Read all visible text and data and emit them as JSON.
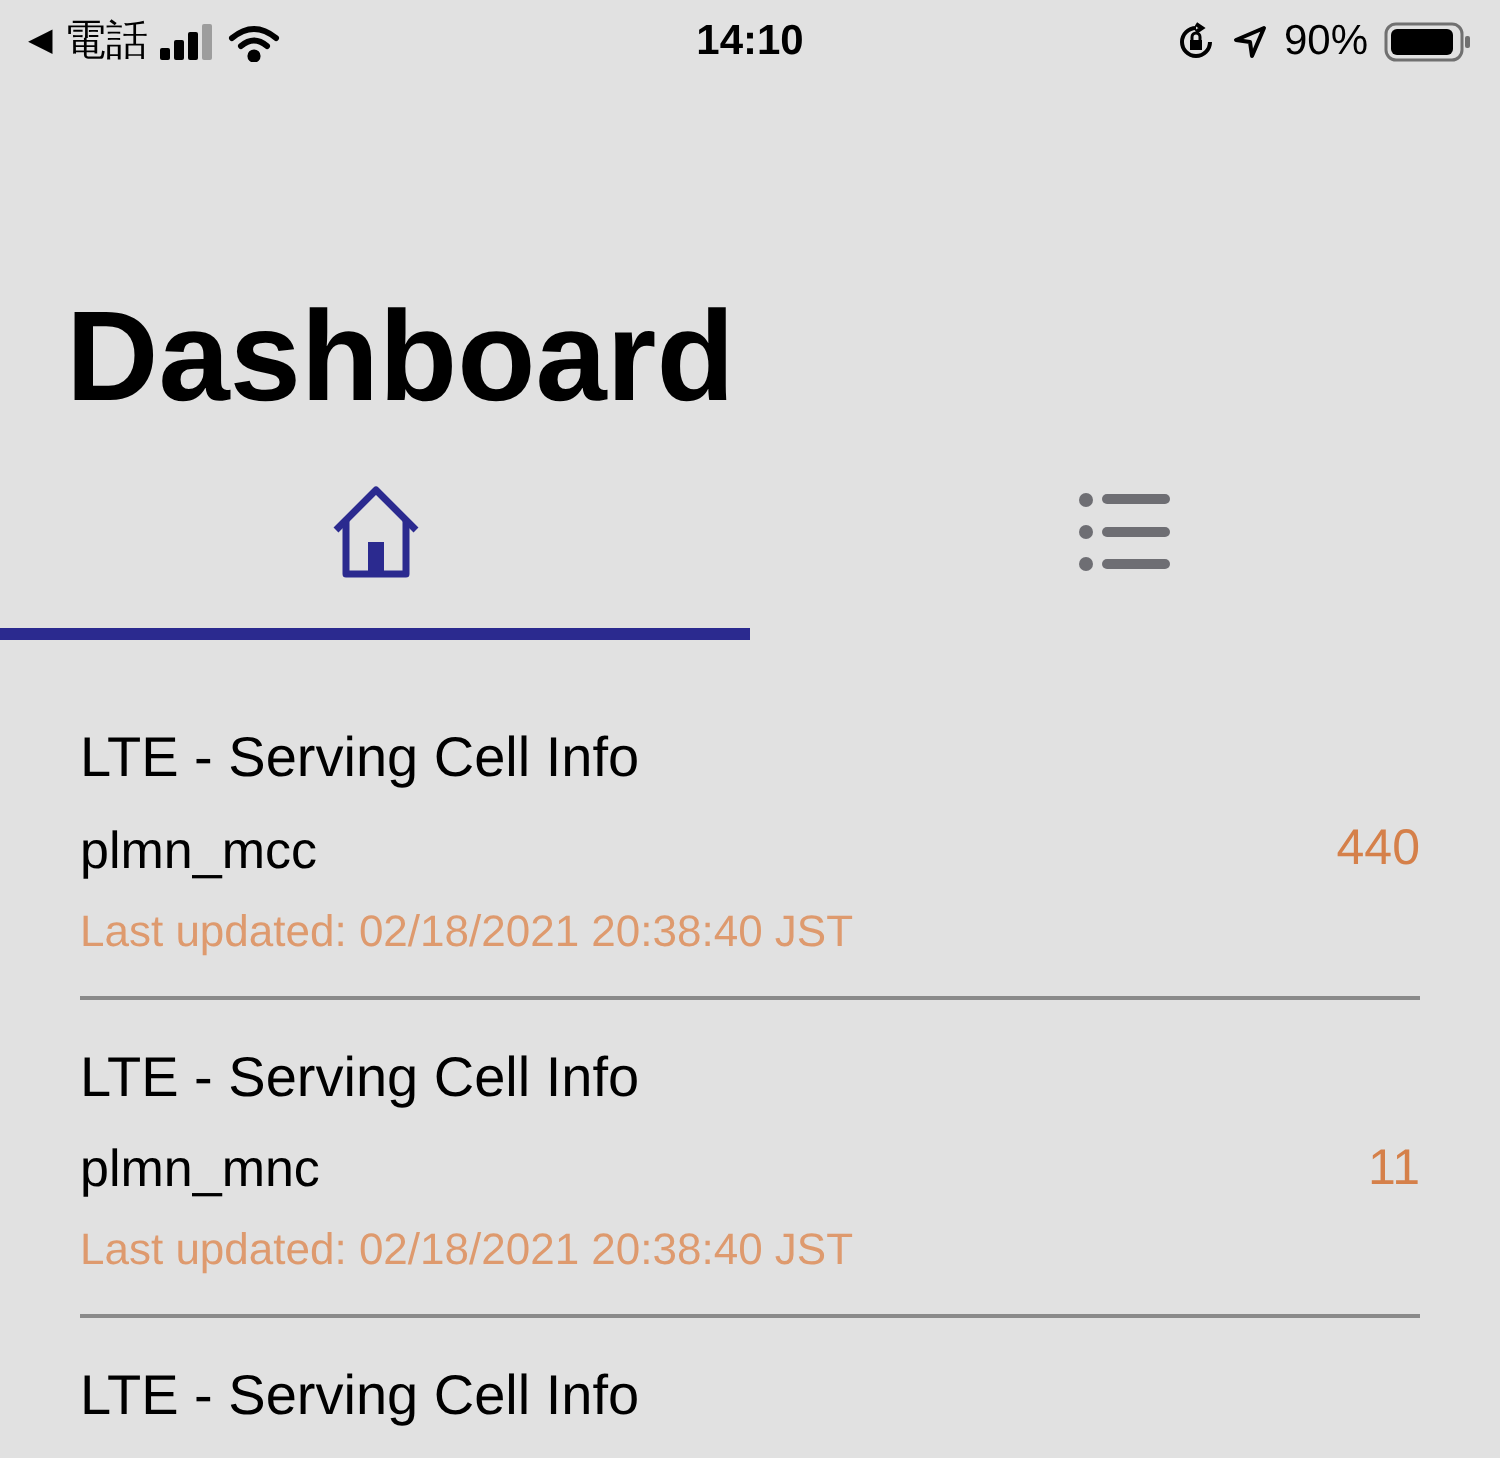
{
  "status_bar": {
    "back": "◀",
    "carrier": "電話",
    "time": "14:10",
    "battery": "90%"
  },
  "title": "Dashboard",
  "tabs": [
    {
      "kind": "home",
      "selected": true
    },
    {
      "kind": "list",
      "selected": false
    }
  ],
  "items": [
    {
      "title": "LTE - Serving Cell Info",
      "name": "plmn_mcc",
      "value": "440",
      "updated": "Last updated: 02/18/2021 20:38:40 JST"
    },
    {
      "title": "LTE - Serving Cell Info",
      "name": "plmn_mnc",
      "value": "11",
      "updated": "Last updated: 02/18/2021 20:38:40 JST"
    },
    {
      "title": "LTE - Serving Cell Info"
    }
  ]
}
